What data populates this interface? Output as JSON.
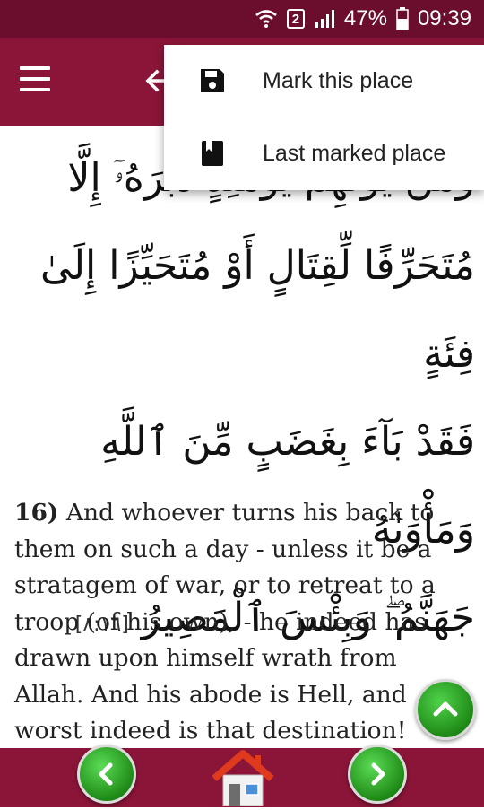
{
  "status_bar": {
    "battery": "47%",
    "time": "09:39",
    "sim": "2",
    "icons": [
      "wifi-icon",
      "sim-icon",
      "signal-icon",
      "battery-icon"
    ]
  },
  "app_bar": {
    "menu_icon": "hamburger-menu-icon",
    "back_icon": "back-arrow-icon"
  },
  "popup_menu": {
    "items": [
      {
        "label": "Mark this place",
        "icon": "save-icon"
      },
      {
        "label": "Last marked place",
        "icon": "bookmark-icon"
      }
    ]
  },
  "verse": {
    "arabic_lines": [
      "وَمَن يُوَلِّهِمْ يَوْمَئِذٍ دُبُرَهُۥٓ إِلَّا",
      "مُتَحَرِّفًا لِّقِتَالٍ أَوْ مُتَحَيِّزًا إِلَىٰ فِئَةٍ",
      "فَقَدْ بَآءَ بِغَضَبٍ مِّنَ ٱللَّهِ وَمَأْوَىٰهُ",
      "جَهَنَّمُ ۖ وَبِئْسَ ٱلْمَصِيرُ"
    ],
    "reference": "[٨:١٦]",
    "number": "16)",
    "translation": "And whoever turns his back to them on such a day - unless it be a stratagem of war, or to retreat to a troop (of his own), - he indeed has drawn upon himself wrath from Allah. And his abode is Hell, and worst indeed is that destination!"
  },
  "colors": {
    "status_bar": "#6b0d2c",
    "app_bar": "#8a1538",
    "accent_green": "#1f8a17"
  },
  "bottom_bar": {
    "prev_icon": "chevron-left-icon",
    "home_icon": "home-icon",
    "next_icon": "chevron-right-icon"
  },
  "fab": {
    "icon": "chevron-up-icon"
  }
}
